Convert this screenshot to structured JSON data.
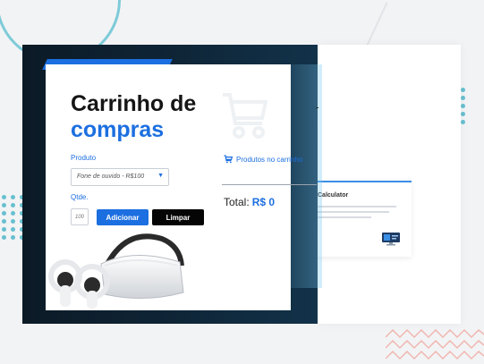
{
  "header": {
    "title_line1": "Carrinho de",
    "title_line2": "compras"
  },
  "form": {
    "product_label": "Produto",
    "product_selected": "Fone de ouvido - R$100",
    "quantity_label": "Qtde.",
    "quantity_value": "100",
    "add_button": "Adicionar",
    "clear_button": "Limpar"
  },
  "cart": {
    "link_label": "Produtos no carrinho",
    "total_label": "Total:",
    "total_value": "R$ 0"
  },
  "background_card": {
    "title": "Calculator"
  },
  "colors": {
    "accent": "#1c6fe0",
    "dark_button": "#050505",
    "backdrop": "#0f2638"
  },
  "icons": [
    "cart-icon",
    "chevron-down-icon",
    "monitor-icon"
  ]
}
